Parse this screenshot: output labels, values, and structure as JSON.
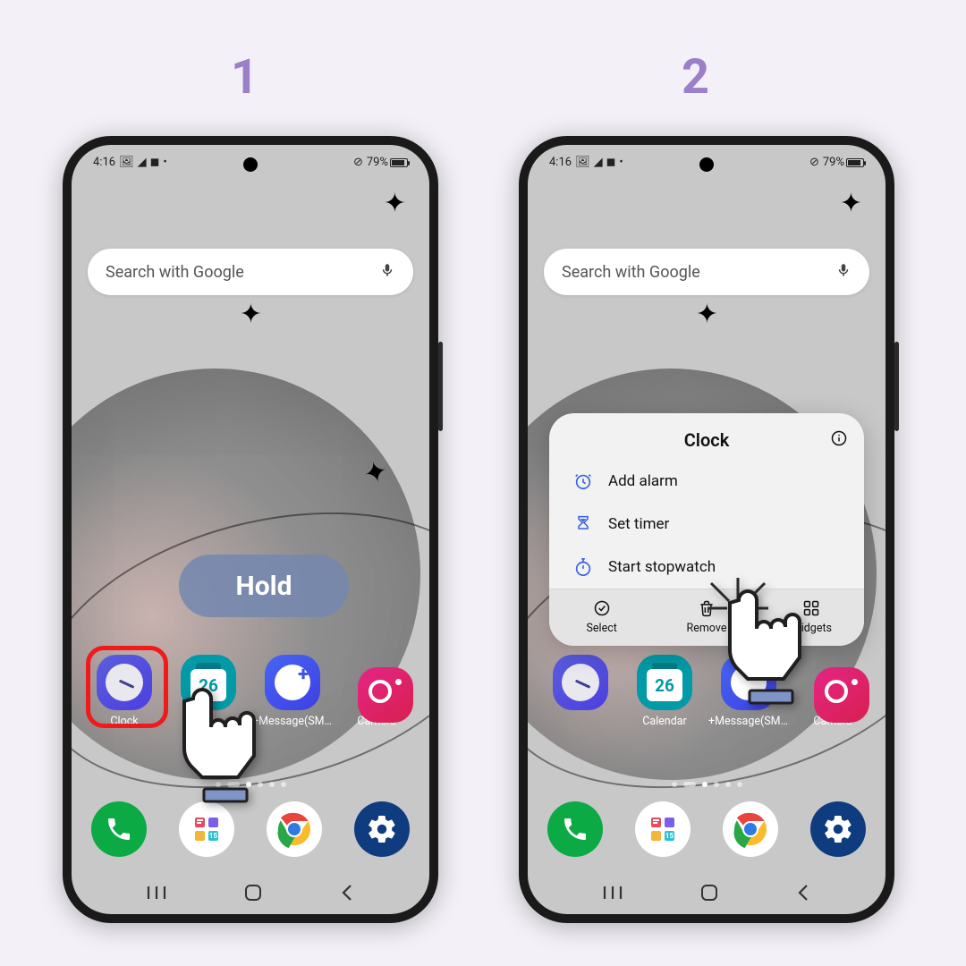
{
  "steps": {
    "one": "1",
    "two": "2"
  },
  "status": {
    "time": "4:16",
    "battery": "79%"
  },
  "search": {
    "placeholder": "Search with Google"
  },
  "hold_label": "Hold",
  "apps_row_1": {
    "clock": "Clock",
    "calendar_day": "26",
    "message": "+Message(SM...",
    "camera": "Camera"
  },
  "apps_row_2": {
    "calendar": "Calendar",
    "calendar_day": "26",
    "message": "+Message(SM...",
    "camera": "Camera"
  },
  "context_menu": {
    "title": "Clock",
    "items": {
      "alarm": "Add alarm",
      "timer": "Set timer",
      "stopwatch": "Start stopwatch"
    },
    "actions": {
      "select": "Select",
      "remove": "Remove",
      "widgets": "Widgets"
    }
  }
}
